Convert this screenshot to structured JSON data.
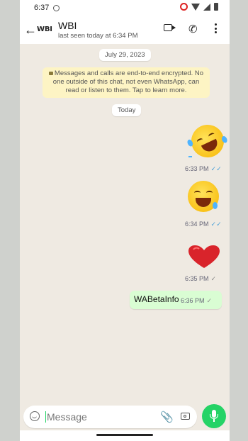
{
  "status_bar": {
    "time": "6:37"
  },
  "header": {
    "back_label": "←",
    "avatar_text": "WBI",
    "title": "WBI",
    "subtitle": "last seen today at 6:34 PM"
  },
  "chat": {
    "date_label": "July 29, 2023",
    "encryption_notice": "Messages and calls are end-to-end encrypted. No one outside of this chat, not even WhatsApp, can read or listen to them. Tap to learn more.",
    "today_label": "Today",
    "messages": [
      {
        "kind": "emoji",
        "icon": "rolling-laughing-emoji",
        "time": "6:33 PM",
        "tick": "✓✓"
      },
      {
        "kind": "emoji",
        "icon": "grinning-sweat-emoji",
        "time": "6:34 PM",
        "tick": "✓✓"
      },
      {
        "kind": "emoji",
        "icon": "red-heart-emoji",
        "time": "6:35 PM",
        "tick": "✓"
      },
      {
        "kind": "text",
        "text": "WABetaInfo",
        "time": "6:36 PM",
        "tick": "✓"
      }
    ]
  },
  "composer": {
    "placeholder": "Message",
    "value": ""
  },
  "colors": {
    "accent": "#25d366",
    "outgoing_bubble": "#d9fdd3",
    "chat_bg": "#efeae2",
    "read_tick": "#4aa0d8"
  }
}
